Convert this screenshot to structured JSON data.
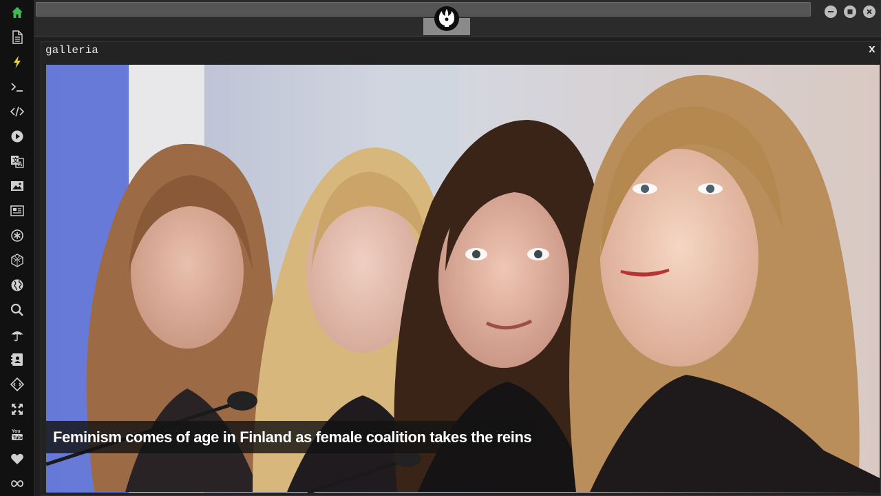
{
  "app": {
    "window_buttons": [
      "minimize",
      "maximize",
      "close"
    ]
  },
  "sidebar": {
    "items": [
      {
        "name": "home-icon",
        "color": "#3fb950"
      },
      {
        "name": "document-icon",
        "color": "#d0d0d0"
      },
      {
        "name": "lightning-icon",
        "color": "#e8d44d"
      },
      {
        "name": "terminal-icon",
        "color": "#d0d0d0"
      },
      {
        "name": "code-icon",
        "color": "#d0d0d0"
      },
      {
        "name": "play-icon",
        "color": "#d0d0d0"
      },
      {
        "name": "translate-icon",
        "color": "#d0d0d0"
      },
      {
        "name": "image-icon",
        "color": "#d0d0d0"
      },
      {
        "name": "newspaper-icon",
        "color": "#d0d0d0"
      },
      {
        "name": "asterisk-icon",
        "color": "#d0d0d0"
      },
      {
        "name": "cube-icon",
        "color": "#d0d0d0"
      },
      {
        "name": "globe-icon",
        "color": "#d0d0d0"
      },
      {
        "name": "search-icon",
        "color": "#d0d0d0"
      },
      {
        "name": "umbrella-icon",
        "color": "#d0d0d0"
      },
      {
        "name": "contact-card-icon",
        "color": "#d0d0d0"
      },
      {
        "name": "network-icon",
        "color": "#d0d0d0"
      },
      {
        "name": "expand-icon",
        "color": "#d0d0d0"
      },
      {
        "name": "youtube-icon",
        "color": "#d0d0d0"
      },
      {
        "name": "heart-icon",
        "color": "#d0d0d0"
      },
      {
        "name": "infinity-icon",
        "color": "#d0d0d0"
      }
    ]
  },
  "topbar": {
    "logo_icon": "rebel-alliance-icon"
  },
  "gallery": {
    "title": "galleria",
    "close_label": "x",
    "caption": "Feminism comes of age in Finland as female coalition takes the reins"
  }
}
